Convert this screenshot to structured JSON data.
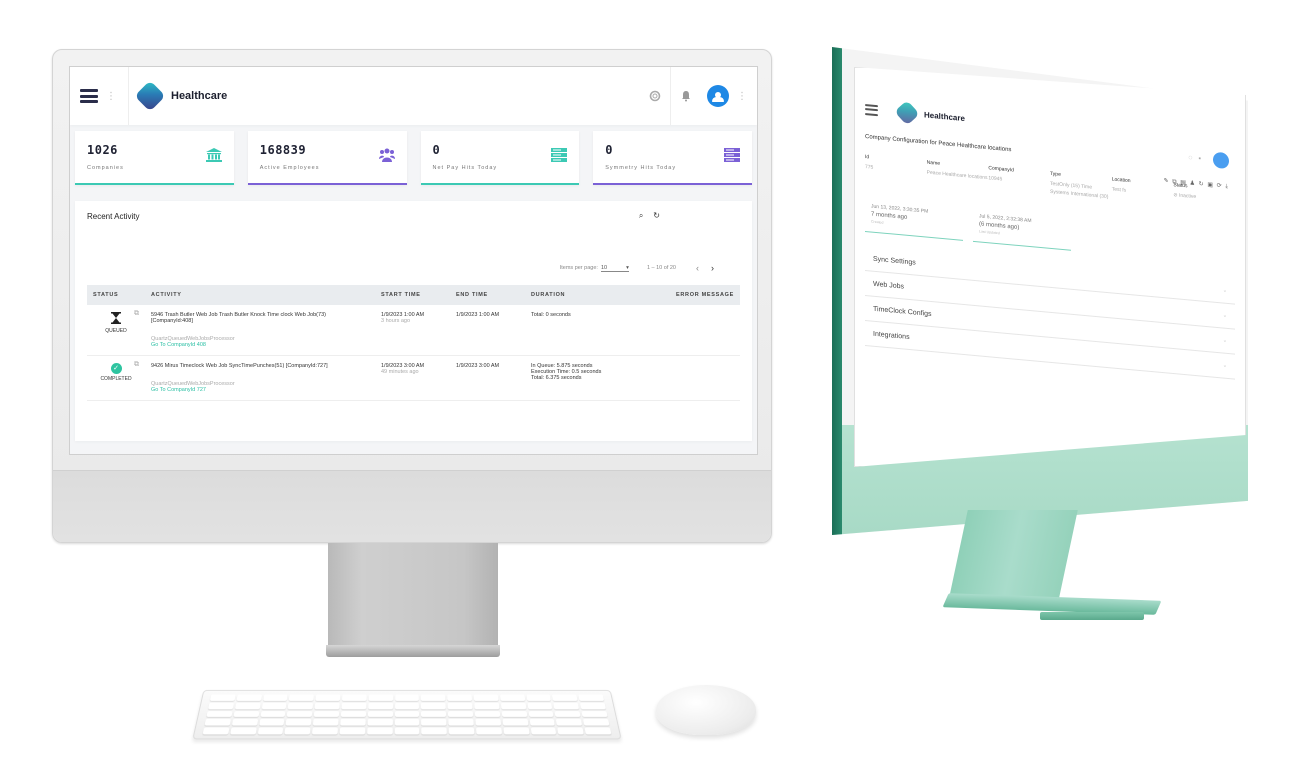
{
  "left_app": {
    "brand": "Healthcare",
    "header_icons": [
      "help-lifebuoy-icon",
      "bell-icon",
      "user-avatar"
    ],
    "stats": [
      {
        "value": "1026",
        "label": "Companies",
        "icon": "bank-icon",
        "color": "#3cc9b4"
      },
      {
        "value": "168839",
        "label": "Active Employees",
        "icon": "users-icon",
        "color": "#7b61d6"
      },
      {
        "value": "0",
        "label": "Net Pay Hits Today",
        "icon": "server-icon",
        "color": "#3cc9b4"
      },
      {
        "value": "0",
        "label": "Symmetry Hits Today",
        "icon": "server-icon",
        "color": "#7b61d6"
      }
    ],
    "activity": {
      "title": "Recent Activity",
      "search_icon": "⌕",
      "refresh_icon": "↻",
      "pager": {
        "items_per_page_label": "Items per page:",
        "items_per_page_value": "10",
        "range": "1 – 10 of 20",
        "prev": "‹",
        "next": "›"
      },
      "columns": [
        "STATUS",
        "ACTIVITY",
        "START TIME",
        "END TIME",
        "DURATION",
        "ERROR MESSAGE"
      ],
      "rows": [
        {
          "status": "QUEUED",
          "activity": "5946 Trash Butler Web Job Trash Butler Knock Time clock Web Job(73) [CompanyId:408]",
          "processor": "QuartzQueuedWebJobsProcessor",
          "link": "Go To CompanyId 408",
          "start_time": "1/9/2023 1:00 AM",
          "start_relative": "3 hours ago",
          "end_time": "1/9/2023 1:00 AM",
          "duration": [
            "Total: 0 seconds"
          ],
          "error": ""
        },
        {
          "status": "COMPLETED",
          "activity": "9426 Mirus Timeclock Web Job SyncTimePunches(51) [CompanyId:727]",
          "processor": "QuartzQueuedWebJobsProcessor",
          "link": "Go To CompanyId 727",
          "start_time": "1/9/2023 3:00 AM",
          "start_relative": "49 minutes ago",
          "end_time": "1/9/2023 3:00 AM",
          "duration": [
            "In Queue: 5.875 seconds",
            "Execution Time: 0.5 seconds",
            "Total: 6.375 seconds"
          ],
          "error": ""
        }
      ]
    }
  },
  "right_app": {
    "brand": "Healthcare",
    "page_title": "Company Configuration for Peace Healthcare locations",
    "action_icons": "✎ ⧉ ▤ ♟ ↻ ▣ ⟳ ⤓",
    "fields": [
      {
        "label": "Id",
        "value": "775"
      },
      {
        "label": "Name",
        "value": "Peace Healthcare locations"
      },
      {
        "label": "CompanyId",
        "value": "10945"
      },
      {
        "label": "Type",
        "value": "TestOnly (15) Time Systems International (30)"
      },
      {
        "label": "Location",
        "value": "Test fs"
      },
      {
        "label": "Status",
        "value": "Inactive"
      }
    ],
    "dates": [
      {
        "date": "Jun 13, 2022, 3:30:35 PM",
        "relative": "7 months ago",
        "by": "Created"
      },
      {
        "date": "Jul 5, 2022, 2:32:38 AM",
        "relative": "(6 months ago)",
        "by": "Last Updated"
      }
    ],
    "sections": [
      "Sync Settings",
      "Web Jobs",
      "TimeClock Configs",
      "Integrations"
    ]
  }
}
